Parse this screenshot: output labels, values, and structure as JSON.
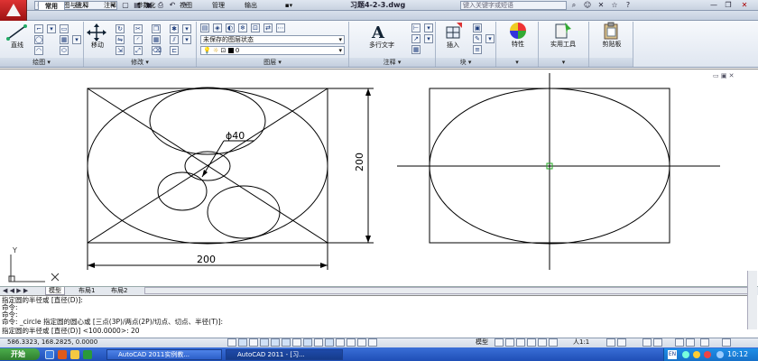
{
  "titlebar": {
    "workspace": "二维草图与注释",
    "file_title": "习题4-2-3.dwg",
    "search_placeholder": "键入关键字或短语",
    "quick_access": [
      "new-icon",
      "open-icon",
      "save-icon",
      "print-icon",
      "undo-icon",
      "redo-icon"
    ]
  },
  "tabs": [
    "常用",
    "插入",
    "注释",
    "参数化",
    "视图",
    "管理",
    "输出"
  ],
  "ribbon": {
    "draw": {
      "title": "绘图",
      "line_label": "直线"
    },
    "modify": {
      "title": "修改",
      "move_label": "移动"
    },
    "layers": {
      "title": "图层",
      "layer_state": "未保存的图层状态",
      "current_layer": "0"
    },
    "annotation": {
      "title": "注释",
      "mtext_label": "多行文字"
    },
    "block": {
      "title": "块",
      "insert_label": "插入"
    },
    "properties": {
      "label": "特性"
    },
    "utilities": {
      "label": "实用工具"
    },
    "clipboard": {
      "label": "剪贴板"
    }
  },
  "drawing": {
    "dim_diameter": "ϕ40",
    "dim_vertical": "200",
    "dim_horizontal": "200",
    "ucs_x": "X",
    "ucs_y": "Y"
  },
  "layout_tabs": [
    "模型",
    "布局1",
    "布局2"
  ],
  "command_lines": [
    "指定圆的半径或 [直径(D)]:",
    "命令:",
    "命令:",
    "命令: _circle 指定圆的圆心或 [三点(3P)/两点(2P)/切点、切点、半径(T)]:",
    "指定圆的半径或 [直径(D)] <100.0000>: 20"
  ],
  "status": {
    "coords": "586.3323, 168.2825, 0.0000",
    "model_label": "模型",
    "scale_label": "人1:1"
  },
  "taskbar": {
    "start": "开始",
    "tasks": [
      "AutoCAD 2011实例教...",
      "AutoCAD 2011 - [习..."
    ],
    "clock": "10:12"
  }
}
